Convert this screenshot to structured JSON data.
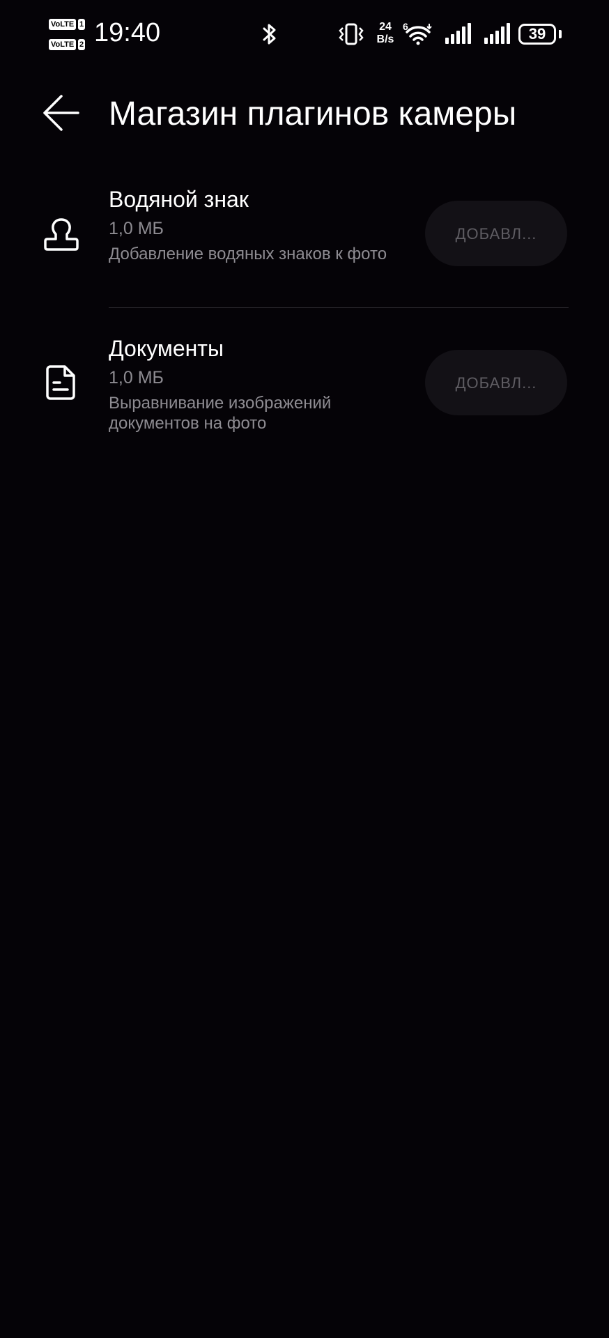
{
  "status_bar": {
    "sim1_label": "VoLTE",
    "sim1_slot": "1",
    "sim2_label": "VoLTE",
    "sim2_slot": "2",
    "time": "19:40",
    "speed_value": "24",
    "speed_unit": "B/s",
    "wifi_label": "6",
    "battery_level": "39",
    "icons": [
      "bluetooth-icon",
      "vibrate-icon",
      "wifi-icon",
      "signal-icon",
      "signal-icon",
      "battery-icon"
    ]
  },
  "header": {
    "title": "Магазин плагинов камеры",
    "back_icon": "arrow-left-icon"
  },
  "plugins": [
    {
      "name": "Водяной знак",
      "size": "1,0 МБ",
      "description": "Добавление водяных знаков к фото",
      "button_label": "ДОБАВЛ...",
      "icon": "stamp-icon"
    },
    {
      "name": "Документы",
      "size": "1,0 МБ",
      "description": "Выравнивание изображений документов на фото",
      "button_label": "ДОБАВЛ...",
      "icon": "document-icon"
    }
  ],
  "colors": {
    "background": "#050307",
    "secondary_text": "#8e8c92",
    "button_bg": "#131116",
    "button_text": "#5f5d63"
  }
}
